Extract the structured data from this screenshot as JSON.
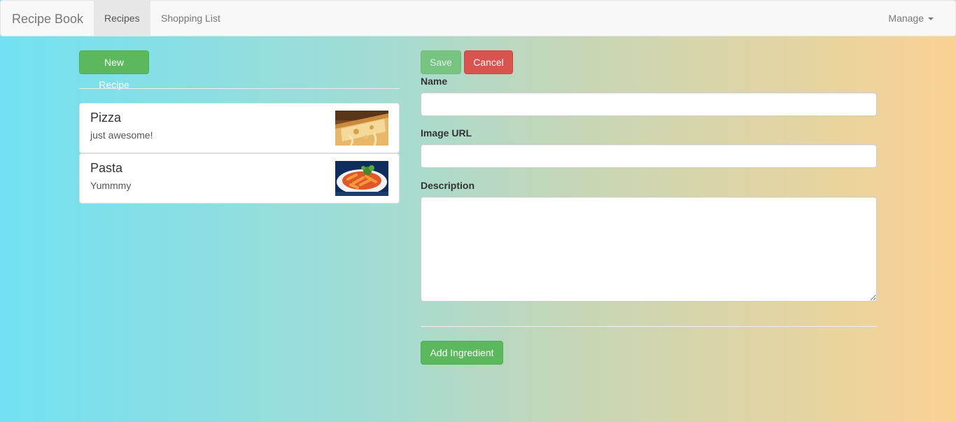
{
  "navbar": {
    "brand": "Recipe Book",
    "items": [
      {
        "label": "Recipes",
        "active": true
      },
      {
        "label": "Shopping List",
        "active": false
      }
    ],
    "manage_label": "Manage"
  },
  "sidebar": {
    "new_recipe_label": "New Recipe",
    "recipes": [
      {
        "name": "Pizza",
        "description": "just awesome!",
        "image": "pizza-photo"
      },
      {
        "name": "Pasta",
        "description": "Yummmy",
        "image": "pasta-photo"
      }
    ]
  },
  "form": {
    "save_label": "Save",
    "cancel_label": "Cancel",
    "name_label": "Name",
    "name_value": "",
    "image_url_label": "Image URL",
    "image_url_value": "",
    "description_label": "Description",
    "description_value": "",
    "add_ingredient_label": "Add Ingredient"
  },
  "colors": {
    "success": "#5cb85c",
    "danger": "#d9534f",
    "gradient_start": "#72e1f3",
    "gradient_end": "#fbd194"
  }
}
